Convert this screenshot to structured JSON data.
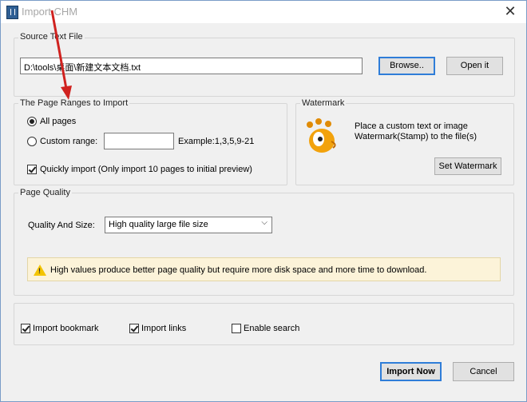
{
  "window": {
    "title": "Import CHM"
  },
  "source": {
    "group_label": "Source Text File",
    "path_value": "D:\\tools\\桌面\\新建文本文档.txt",
    "browse_label": "Browse..",
    "open_label": "Open it"
  },
  "ranges": {
    "group_label": "The Page Ranges to Import",
    "all_pages_label": "All pages",
    "all_pages_selected": true,
    "custom_range_label": "Custom range:",
    "custom_range_value": "",
    "example_text": "Example:1,3,5,9-21",
    "quick_import_label": "Quickly import (Only import 10 pages to  initial  preview)",
    "quick_import_checked": true
  },
  "watermark": {
    "group_label": "Watermark",
    "icon": "gimp-mascot-icon",
    "line1": "Place a custom text or image",
    "line2": "Watermark(Stamp) to the file(s)",
    "button_label": "Set Watermark"
  },
  "quality": {
    "group_label": "Page Quality",
    "field_label": "Quality And Size:",
    "selected": "High quality large file size",
    "warning": "High values produce better page quality but require more disk space and more time to download."
  },
  "options": {
    "import_bookmark": {
      "label": "Import bookmark",
      "checked": true
    },
    "import_links": {
      "label": "Import links",
      "checked": true
    },
    "enable_search": {
      "label": "Enable search",
      "checked": false
    }
  },
  "footer": {
    "import_now_label": "Import Now",
    "cancel_label": "Cancel"
  },
  "colors": {
    "accent": "#2f7dd8",
    "annotation_arrow": "#d0221f",
    "warning_bg": "#fcf3d9"
  }
}
